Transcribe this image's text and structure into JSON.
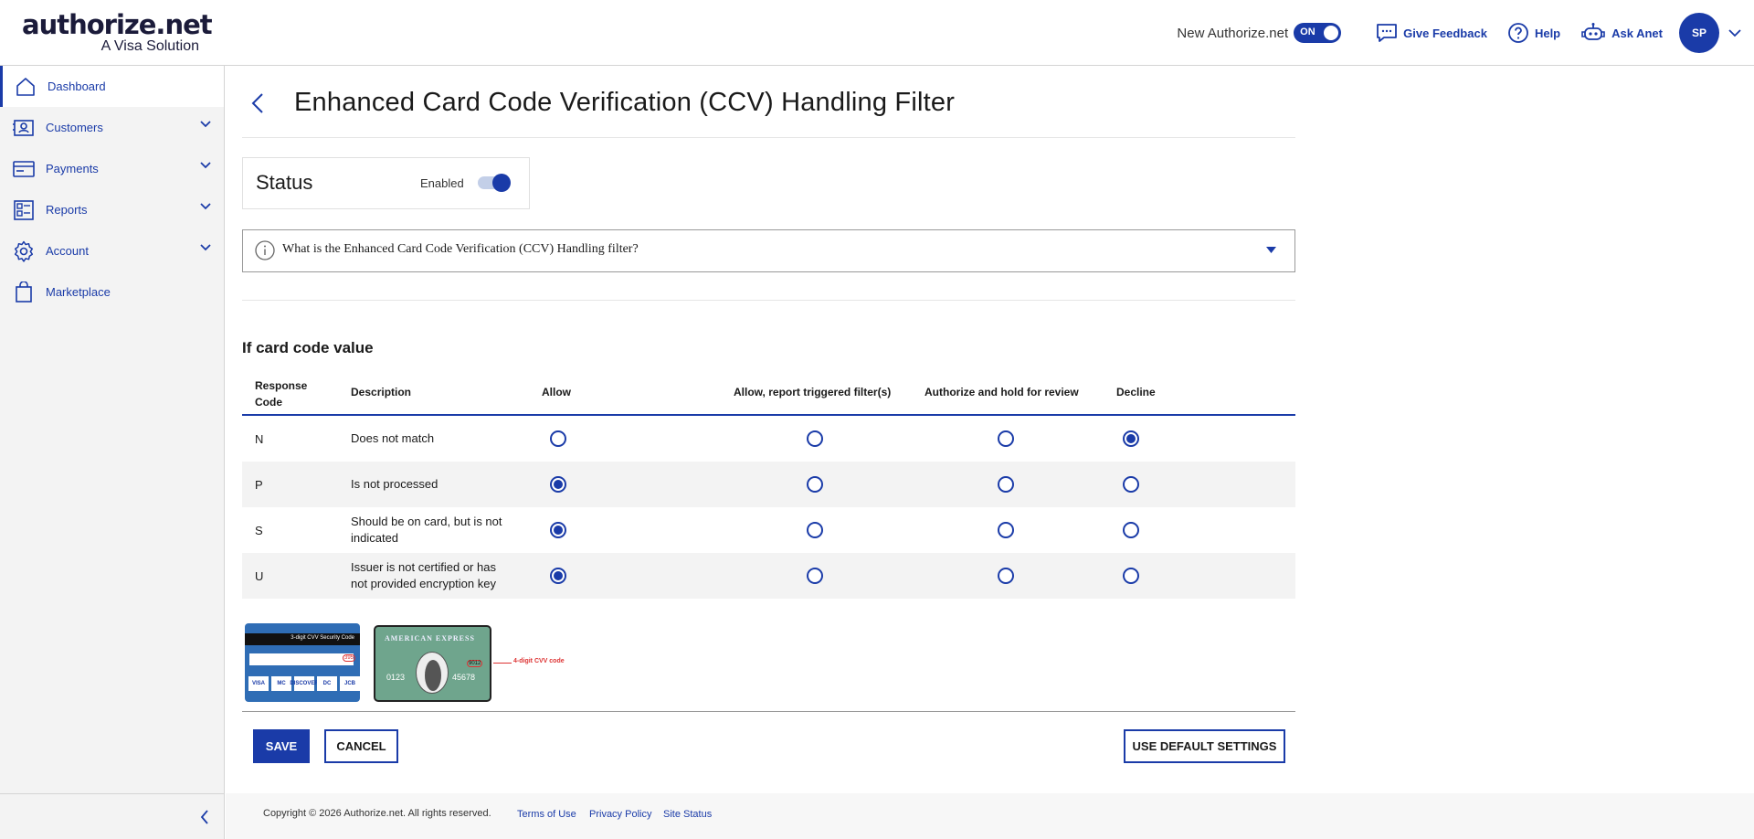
{
  "header": {
    "logo_main": "authorize.net",
    "logo_sub": "A Visa Solution",
    "new_anet_label": "New Authorize.net",
    "new_anet_toggle": "ON",
    "give_feedback": "Give Feedback",
    "help": "Help",
    "ask_anet": "Ask Anet",
    "avatar_initials": "SP"
  },
  "sidebar": {
    "items": [
      {
        "label": "Dashboard",
        "icon": "home-icon",
        "active": true,
        "expandable": false
      },
      {
        "label": "Customers",
        "icon": "customers-icon",
        "active": false,
        "expandable": true
      },
      {
        "label": "Payments",
        "icon": "payments-icon",
        "active": false,
        "expandable": true
      },
      {
        "label": "Reports",
        "icon": "reports-icon",
        "active": false,
        "expandable": true
      },
      {
        "label": "Account",
        "icon": "gear-icon",
        "active": false,
        "expandable": true
      },
      {
        "label": "Marketplace",
        "icon": "bag-icon",
        "active": false,
        "expandable": false
      }
    ]
  },
  "page": {
    "title": "Enhanced Card Code Verification (CCV) Handling Filter",
    "status": {
      "title": "Status",
      "enabled_label": "Enabled",
      "enabled": true
    },
    "info": {
      "text": "What is the Enhanced Card Code Verification (CCV) Handling filter?"
    },
    "section_title": "If card code value",
    "table": {
      "headers": [
        "Response Code",
        "Description",
        "Allow",
        "Allow, report triggered filter(s)",
        "Authorize and hold for review",
        "Decline"
      ],
      "rows": [
        {
          "code": "N",
          "description": "Does not match",
          "selected": 3
        },
        {
          "code": "P",
          "description": "Is not processed",
          "selected": 0
        },
        {
          "code": "S",
          "description": "Should be on card, but is not indicated",
          "selected": 0
        },
        {
          "code": "U",
          "description": "Issuer is not certified or has not provided encryption key",
          "selected": 0
        }
      ]
    },
    "cards": {
      "visa_stripe_label": "3-digit CVV Security Code",
      "visa_cvv": "395",
      "visa_logos": [
        "VISA",
        "MC",
        "DISCOVER",
        "DC",
        "JCB"
      ],
      "amex_name": "AMERICAN EXPRESS",
      "amex_num1": "0123",
      "amex_num2": "45678",
      "amex_cvv": "9012",
      "amex_note": "4-digit CVV code"
    },
    "buttons": {
      "save": "SAVE",
      "cancel": "CANCEL",
      "use_default": "USE DEFAULT SETTINGS"
    }
  },
  "footer": {
    "copyright": "Copyright © 2026 Authorize.net. All rights reserved.",
    "terms": "Terms of Use",
    "privacy": "Privacy Policy",
    "site_status": "Site Status"
  },
  "colors": {
    "accent": "#1a3ba8",
    "sidebar_bg": "#f3f3f3"
  }
}
